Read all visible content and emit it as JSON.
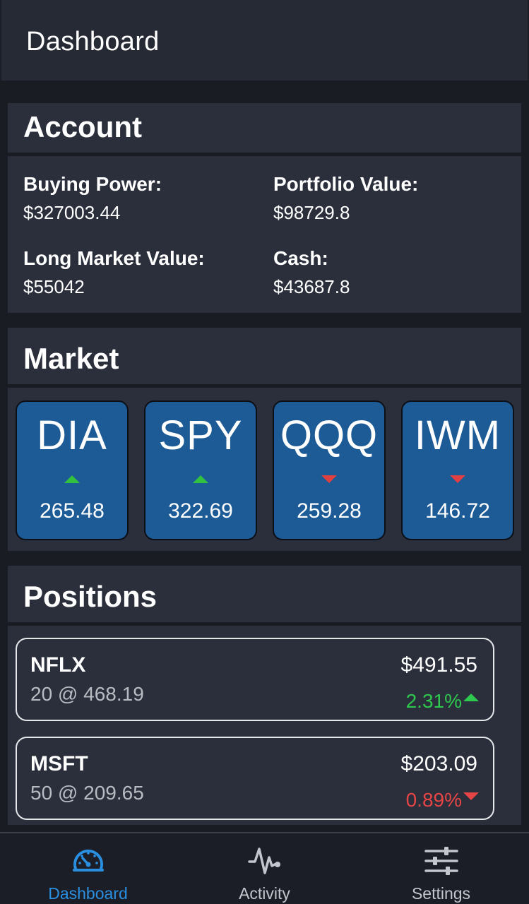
{
  "header": {
    "title": "Dashboard"
  },
  "account": {
    "title": "Account",
    "items": [
      {
        "label": "Buying Power:",
        "value": "$327003.44"
      },
      {
        "label": "Portfolio Value:",
        "value": "$98729.8"
      },
      {
        "label": "Long Market Value:",
        "value": "$55042"
      },
      {
        "label": "Cash:",
        "value": "$43687.8"
      }
    ]
  },
  "market": {
    "title": "Market",
    "tiles": [
      {
        "symbol": "DIA",
        "price": "265.48",
        "direction": "up"
      },
      {
        "symbol": "SPY",
        "price": "322.69",
        "direction": "up"
      },
      {
        "symbol": "QQQ",
        "price": "259.28",
        "direction": "down"
      },
      {
        "symbol": "IWM",
        "price": "146.72",
        "direction": "down"
      }
    ]
  },
  "positions": {
    "title": "Positions",
    "items": [
      {
        "symbol": "NFLX",
        "quantity": "20 @ 468.19",
        "value": "$491.55",
        "change": "2.31%",
        "direction": "up"
      },
      {
        "symbol": "MSFT",
        "quantity": "50 @ 209.65",
        "value": "$203.09",
        "change": "0.89%",
        "direction": "down"
      }
    ]
  },
  "nav": {
    "items": [
      {
        "label": "Dashboard",
        "icon": "speedometer-icon",
        "active": true
      },
      {
        "label": "Activity",
        "icon": "activity-pulse-icon",
        "active": false
      },
      {
        "label": "Settings",
        "icon": "sliders-icon",
        "active": false
      }
    ]
  },
  "colors": {
    "background": "#191c23",
    "card": "#2b2f3b",
    "tile": "#1d5b97",
    "up": "#2dc84d",
    "down": "#e64545",
    "accent": "#2a8fe0"
  }
}
